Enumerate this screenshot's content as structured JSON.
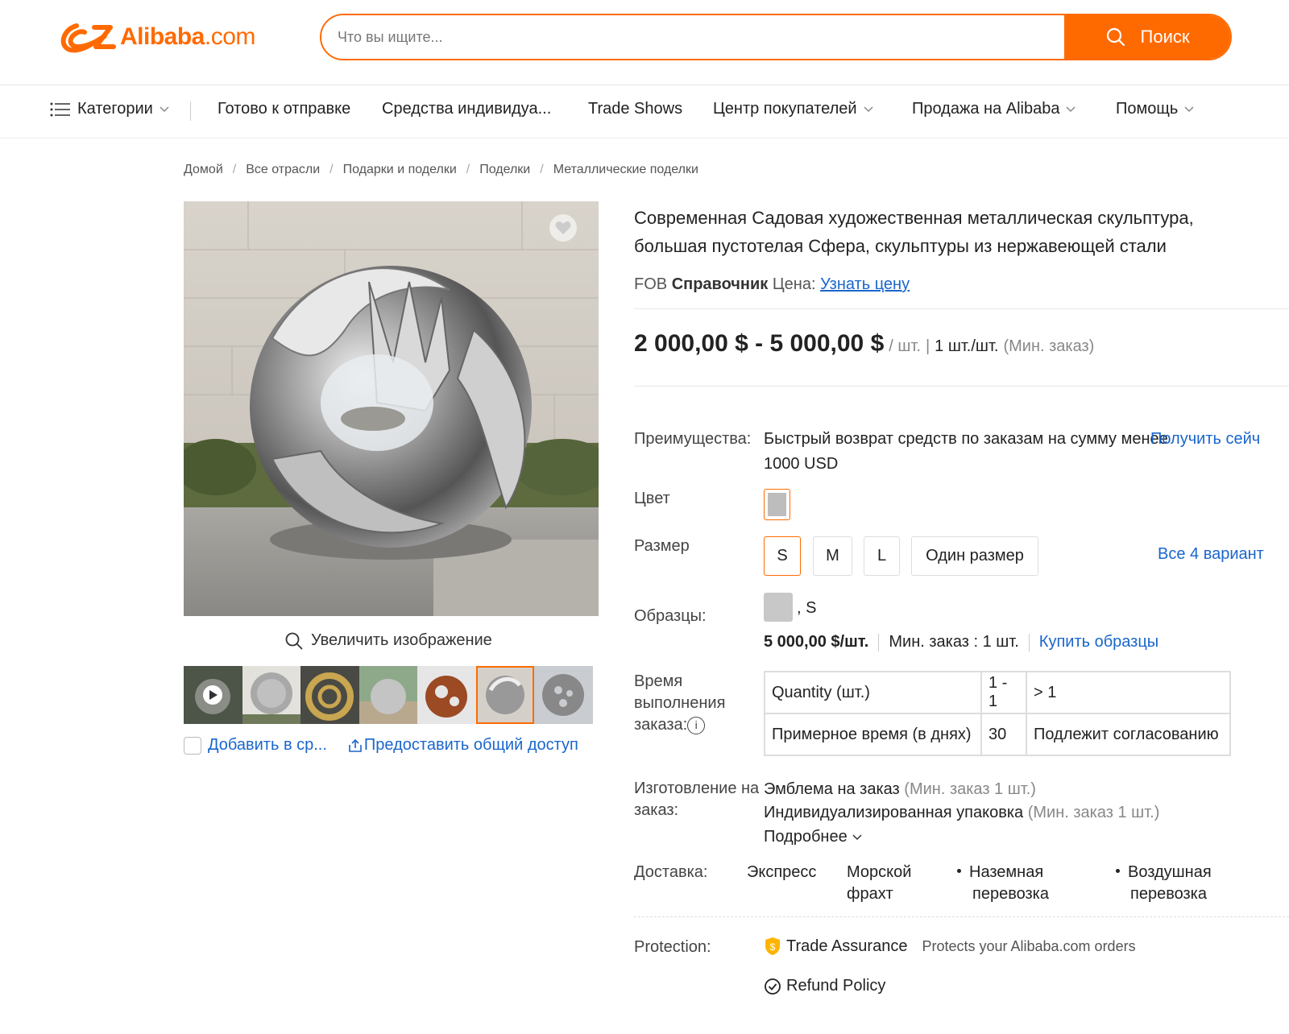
{
  "header": {
    "logo_text": "Alibaba",
    "logo_suffix": ".com",
    "search_placeholder": "Что вы ищите...",
    "search_button": "Поиск"
  },
  "nav": {
    "categories": "Категории",
    "items": [
      "Готово к отправке",
      "Средства индивидуа...",
      "Trade Shows",
      "Центр покупателей",
      "Продажа на Alibaba",
      "Помощь"
    ]
  },
  "breadcrumb": [
    "Домой",
    "Все отрасли",
    "Подарки и поделки",
    "Поделки",
    "Металлические поделки"
  ],
  "breadcrumb_sep": "/",
  "gallery": {
    "zoom_label": "Увеличить изображение",
    "compare_label": "Добавить в ср...",
    "share_label": "Предоставить общий доступ"
  },
  "product": {
    "title_line1": "Современная Садовая художественная металлическая скульптура,",
    "title_line2": "большая пустотелая Сфера, скульптуры из нержавеющей стали",
    "ref_fob": "FOB",
    "ref_bold": "Справочник",
    "ref_price": "Цена:",
    "ref_link": "Узнать цену",
    "price_range": "2 000,00 $ - 5 000,00 $",
    "price_unit": "/ шт.",
    "price_sep": "|",
    "min_order": "1 шт./шт.",
    "min_order_note": "(Мин. заказ)"
  },
  "benefits": {
    "label": "Преимущества:",
    "text": "Быстрый возврат средств по заказам на сумму менее 1000 USD",
    "link": "Получить сейч"
  },
  "color": {
    "label": "Цвет",
    "swatch": "#bdbdbd"
  },
  "size": {
    "label": "Размер",
    "options": [
      "S",
      "M",
      "L",
      "Один размер"
    ],
    "selected": "S",
    "all_link": "Все 4 вариант"
  },
  "samples": {
    "label": "Образцы:",
    "variant": ", S",
    "price": "5 000,00 $/шт.",
    "min": "Мин. заказ : 1 шт.",
    "buy_link": "Купить образцы"
  },
  "lead_time": {
    "label_line1": "Время",
    "label_line2": "выполнения",
    "label_line3": "заказа:",
    "info_glyph": "i",
    "row1": [
      "Quantity (шт.)",
      "1 - 1",
      "> 1"
    ],
    "row2": [
      "Примерное время (в днях)",
      "30",
      "Подлежит согласованию"
    ]
  },
  "customization": {
    "label_line1": "Изготовление на",
    "label_line2": "заказ:",
    "item1": "Эмблема на заказ",
    "item1_note": "(Мин. заказ 1 шт.)",
    "item2": "Индивидуализированная упаковка",
    "item2_note": "(Мин. заказ 1 шт.)",
    "more": "Подробнее"
  },
  "shipping": {
    "label": "Доставка:",
    "express": "Экспресс",
    "sea_line1": "Морской",
    "sea_line2": "фрахт",
    "land_line1": "Наземная",
    "land_line2": "перевозка",
    "air_line1": "Воздушная",
    "air_line2": "перевозка"
  },
  "protection": {
    "label": "Protection:",
    "trade": "Trade Assurance",
    "trade_note": "Protects your Alibaba.com orders",
    "refund": "Refund Policy"
  },
  "colors": {
    "accent": "#ff6a00",
    "link": "#1a66cc"
  }
}
